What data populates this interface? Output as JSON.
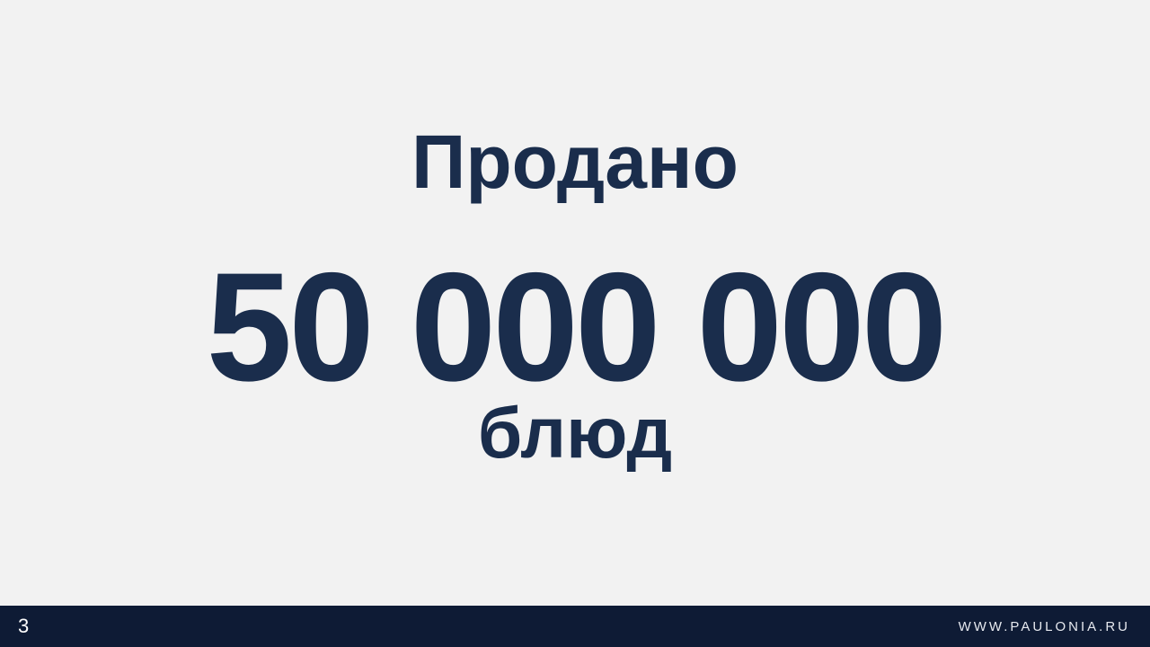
{
  "slide": {
    "heading": "Продано",
    "big_number": "50 000 000",
    "unit": "блюд"
  },
  "footer": {
    "page_number": "3",
    "site_url": "WWW.PAULONIA.RU"
  },
  "colors": {
    "background": "#f2f2f2",
    "text": "#1a2d4c",
    "footer_background": "#0e1b35",
    "footer_text": "#ffffff"
  }
}
